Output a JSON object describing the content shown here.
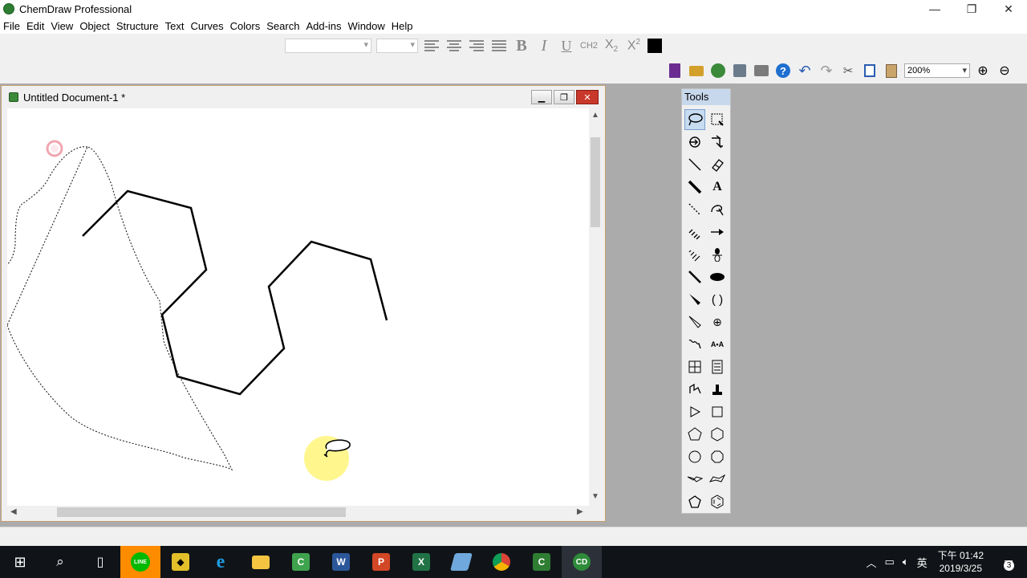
{
  "app": {
    "title": "ChemDraw Professional"
  },
  "window_controls": {
    "minimize": "—",
    "restore": "❐",
    "close": "✕"
  },
  "menu": [
    "File",
    "Edit",
    "View",
    "Object",
    "Structure",
    "Text",
    "Curves",
    "Colors",
    "Search",
    "Add-ins",
    "Window",
    "Help"
  ],
  "format_toolbar": {
    "bold": "B",
    "italic": "I",
    "underline": "U",
    "ch2": "CH2",
    "subscript": "X2",
    "superscript": "X2",
    "text_color": "#000000"
  },
  "main_toolbar": {
    "zoom": "200%"
  },
  "document": {
    "title": "Untitled Document-1 *"
  },
  "tools_palette": {
    "title": "Tools",
    "tools": [
      "lasso-icon",
      "marquee-icon",
      "structure-perspective-icon",
      "mass-fragmentation-icon",
      "solid-bond-icon",
      "eraser-icon",
      "bold-bond-icon",
      "text-icon",
      "dashed-bond-icon",
      "pen-icon",
      "hashed-bond-icon",
      "arrow-icon",
      "hashed-wedge-icon",
      "orbital-icon",
      "bold-wedge-icon",
      "drawing-element-icon",
      "wedge-bond-icon",
      "brackets-icon",
      "hollow-wedge-icon",
      "charge-icon",
      "wavy-bond-icon",
      "atom-mapping-icon",
      "table-icon",
      "tlc-plate-icon",
      "chain-icon",
      "stamp-icon",
      "triangle-icon",
      "square-icon",
      "pentagon-icon",
      "hexagon-icon",
      "cyclopentane-icon",
      "cyclohexane-icon",
      "chair-left-icon",
      "chair-right-icon",
      "cyclopentadiene-icon",
      "benzene-icon"
    ]
  },
  "taskbar": {
    "time": "下午 01:42",
    "date": "2019/3/25",
    "ime": "英",
    "notifications": "3"
  }
}
